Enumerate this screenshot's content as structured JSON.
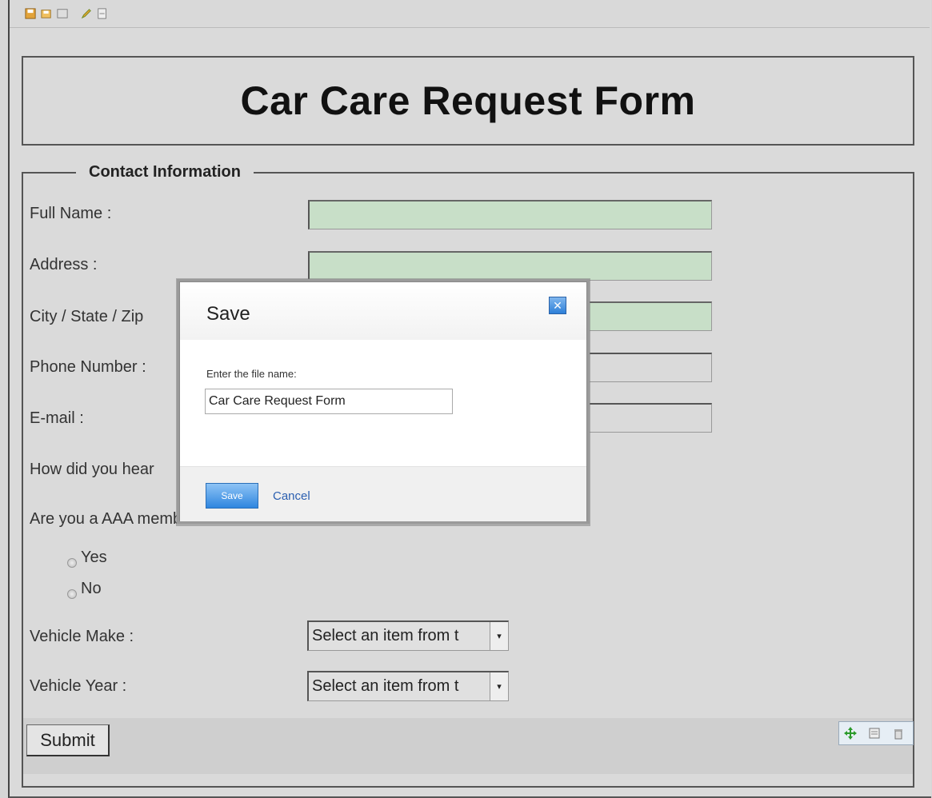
{
  "form": {
    "title": "Car Care Request Form",
    "section_title": "Contact Information",
    "fields": {
      "full_name": "Full Name :",
      "address": "Address :",
      "city_state_zip": "City / State / Zip",
      "phone": "Phone Number :",
      "email": "E-mail :",
      "how_heard": "How did you hear",
      "aaa_member": "Are you a AAA member?"
    },
    "radio_options": {
      "yes": "Yes",
      "no": "No"
    },
    "vehicle_make_label": "Vehicle Make :",
    "vehicle_year_label": "Vehicle Year :",
    "select_placeholder": "Select an item from t",
    "submit_label": "Submit"
  },
  "dialog": {
    "title": "Save",
    "prompt": "Enter the file name:",
    "file_name_value": "Car Care Request Form",
    "save_label": "Save",
    "cancel_label": "Cancel",
    "close_glyph": "✕"
  },
  "colors": {
    "required_field": "#c8dfc8",
    "dialog_button": "#2f86df",
    "link": "#2b5fb0"
  },
  "icons": {
    "toolbar": [
      "save-icon",
      "save-as-icon",
      "preview-icon",
      "edit-icon",
      "form-icon"
    ],
    "control": [
      "move-icon",
      "properties-icon",
      "delete-icon"
    ]
  }
}
